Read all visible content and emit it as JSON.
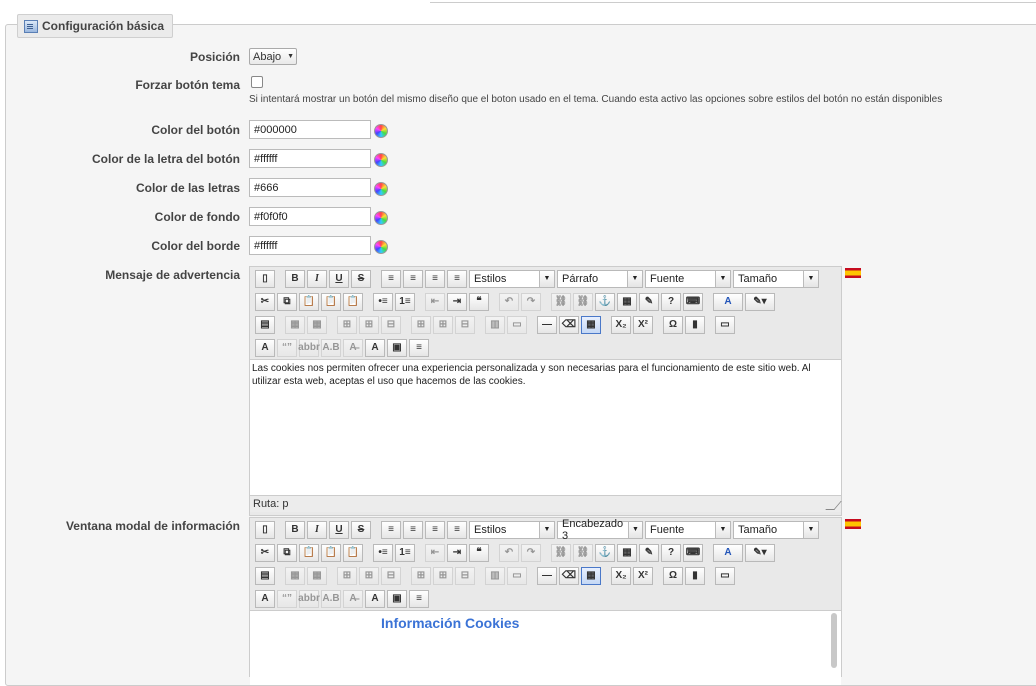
{
  "section": {
    "title": "Configuración básica"
  },
  "fields": {
    "posicion": {
      "label": "Posición",
      "value": "Abajo"
    },
    "forzar": {
      "label": "Forzar botón tema",
      "help": "Si intentará mostrar un botón del mismo diseño que el boton usado en el tema. Cuando esta activo las opciones sobre estilos del botón no están disponibles"
    },
    "color_boton": {
      "label": "Color del botón",
      "value": "#000000"
    },
    "color_letra_boton": {
      "label": "Color de la letra del botón",
      "value": "#ffffff"
    },
    "color_letras": {
      "label": "Color de las letras",
      "value": "#666"
    },
    "color_fondo": {
      "label": "Color de fondo",
      "value": "#f0f0f0"
    },
    "color_borde": {
      "label": "Color del borde",
      "value": "#ffffff"
    }
  },
  "editor1": {
    "label": "Mensaje de advertencia",
    "styles": "Estilos",
    "format": "Párrafo",
    "font": "Fuente",
    "size": "Tamaño",
    "content": "Las cookies nos permiten ofrecer una experiencia personalizada y son necesarias para el funcionamiento de este sitio web. Al utilizar esta web, aceptas el uso que hacemos de las cookies.",
    "path": "Ruta: p"
  },
  "editor2": {
    "label": "Ventana modal de información",
    "styles": "Estilos",
    "format": "Encabezado 3",
    "font": "Fuente",
    "size": "Tamaño",
    "heading": "Información Cookies"
  },
  "icons": {
    "bold": "B",
    "italic": "I",
    "underline": "U",
    "strike": "S",
    "blockquote": "❝",
    "sub": "X₂",
    "sup": "X²",
    "omega": "Ω",
    "textA": "A"
  },
  "colors": {
    "accent": "#3b73d6",
    "flag_red": "#c60b1e",
    "flag_yellow": "#ffc400"
  }
}
